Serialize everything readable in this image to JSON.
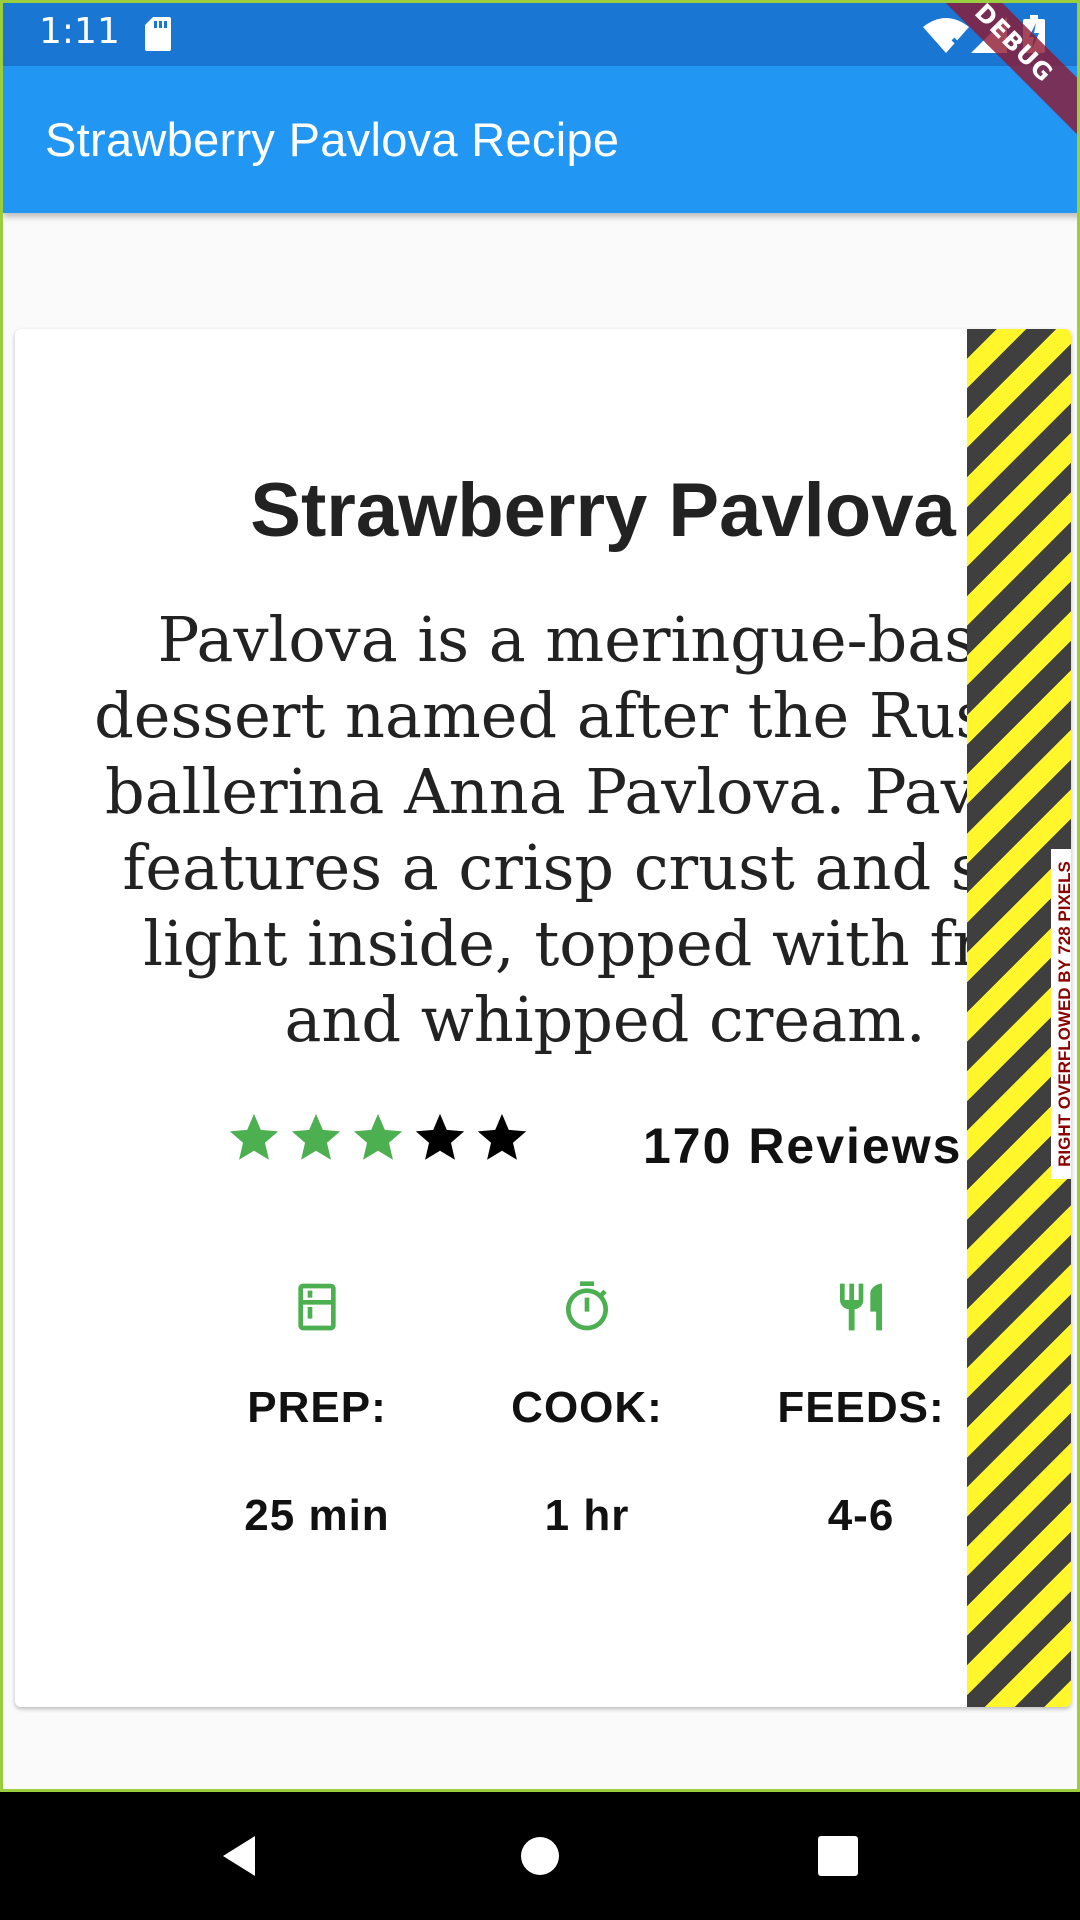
{
  "status_bar": {
    "time": "1:11",
    "icons": [
      "sd-card-icon",
      "wifi-icon",
      "signal-icon",
      "battery-icon"
    ]
  },
  "app_bar": {
    "title": "Strawberry Pavlova Recipe",
    "color": "#2196f3"
  },
  "debug_banner": {
    "label": "DEBUG"
  },
  "recipe": {
    "title": "Strawberry Pavlova",
    "description_lines": [
      "Pavlova is a meringue-based",
      "dessert named after the Russian",
      "ballerina Anna Pavlova. Pavlova",
      "features a crisp crust and soft,",
      "light inside, topped with fruit",
      "and whipped cream."
    ],
    "rating": {
      "filled_stars": 3,
      "total_stars": 5,
      "filled_color": "#4caf50",
      "empty_color": "#000000"
    },
    "reviews_label": "170 Reviews",
    "info": [
      {
        "icon": "kitchen-icon",
        "label": "PREP:",
        "value": "25 min"
      },
      {
        "icon": "timer-icon",
        "label": "COOK:",
        "value": "1 hr"
      },
      {
        "icon": "restaurant-icon",
        "label": "FEEDS:",
        "value": "4-6"
      }
    ],
    "accent_color": "#4caf50"
  },
  "overflow_warning": {
    "label": "RIGHT OVERFLOWED BY 728 PIXELS"
  },
  "nav_bar": {
    "buttons": [
      "back-button",
      "home-button",
      "recents-button"
    ]
  }
}
